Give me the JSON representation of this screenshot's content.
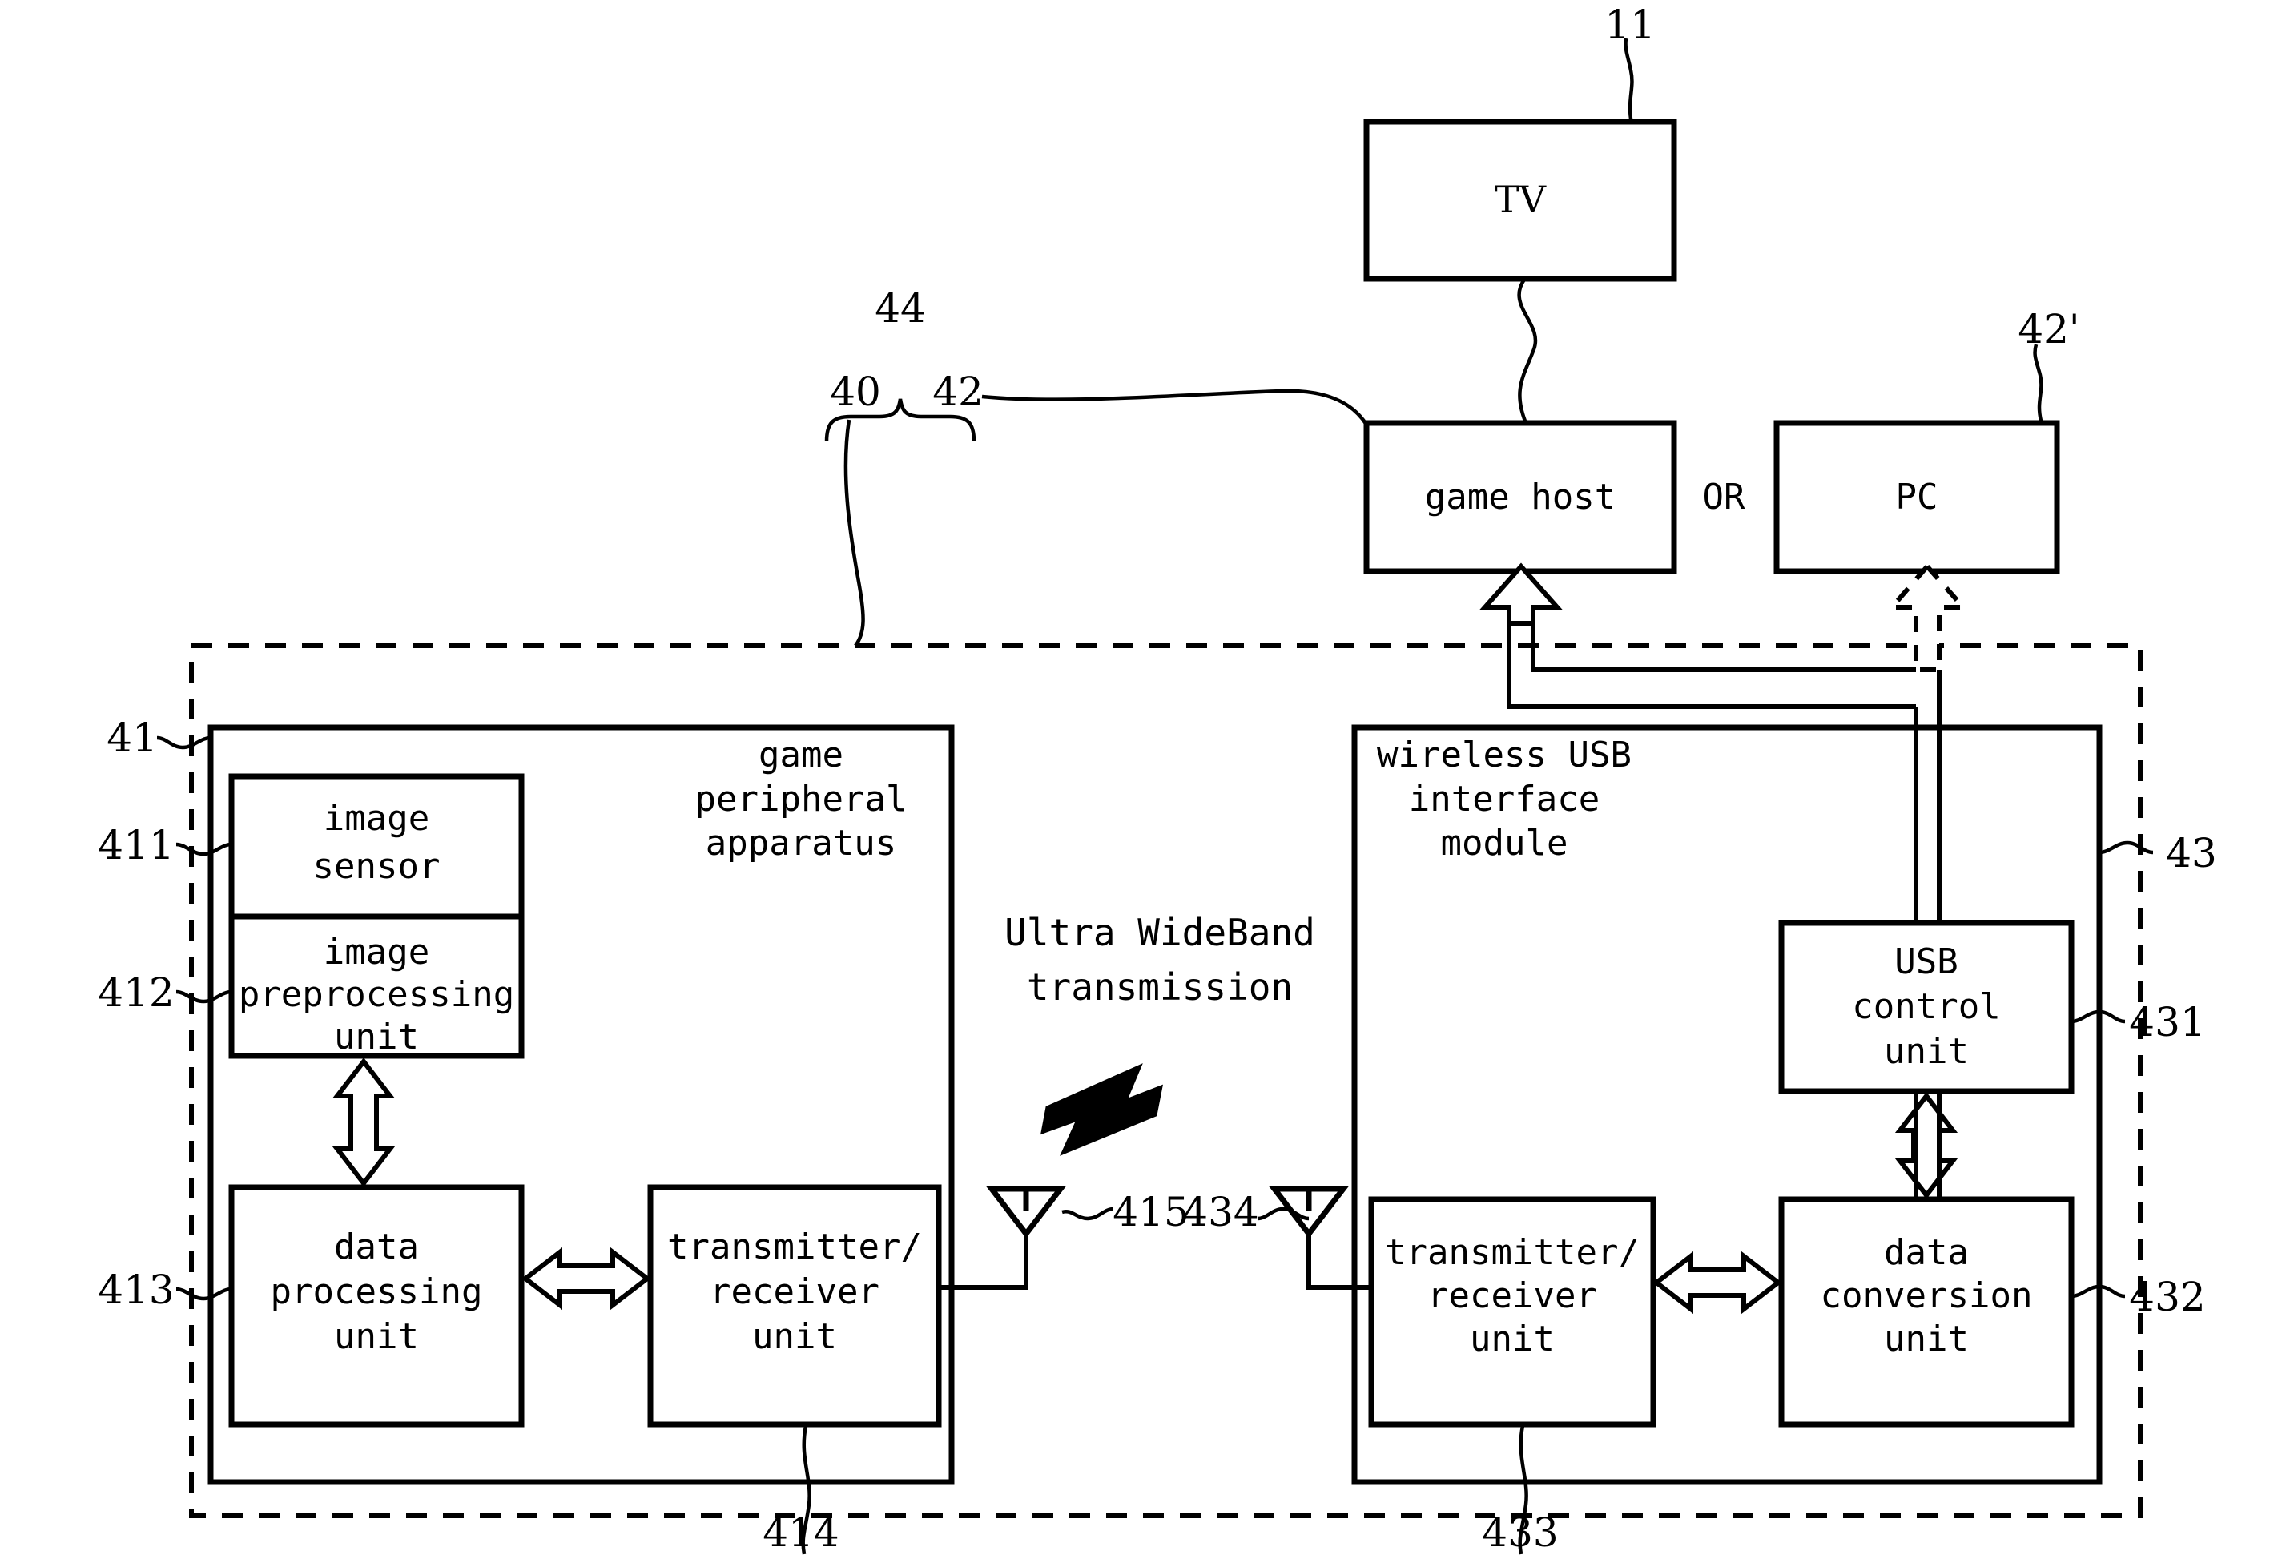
{
  "figure": {
    "type": "patent-block-diagram",
    "title": "Wireless USB game peripheral system block diagram",
    "background_color": "#ffffff",
    "line_color": "#000000"
  },
  "blocks": {
    "tv": {
      "label": "TV",
      "ref": "11"
    },
    "game_host": {
      "label": "game host",
      "ref": "42"
    },
    "or_separator": {
      "label": "OR"
    },
    "pc": {
      "label": "PC",
      "ref": "42'"
    },
    "system_dashed": {
      "ref": "40"
    },
    "brace_group": {
      "ref": "44"
    },
    "game_peripheral_apparatus": {
      "label_line1": "game",
      "label_line2": "peripheral",
      "label_line3": "apparatus",
      "ref": "41"
    },
    "image_sensor": {
      "label_line1": "image",
      "label_line2": "sensor",
      "ref": "411"
    },
    "image_preprocessing_unit": {
      "label_line1": "image",
      "label_line2": "preprocessing",
      "label_line3": "unit",
      "ref": "412"
    },
    "data_processing_unit": {
      "label_line1": "data",
      "label_line2": "processing",
      "label_line3": "unit",
      "ref": "413"
    },
    "peripheral_transceiver": {
      "label_line1": "transmitter/",
      "label_line2": "receiver",
      "label_line3": "unit",
      "ref": "414"
    },
    "peripheral_antenna": {
      "ref": "415"
    },
    "module_antenna": {
      "ref": "434"
    },
    "wireless_usb_interface_module": {
      "label_line1": "wireless USB",
      "label_line2": "interface",
      "label_line3": "module",
      "ref": "43"
    },
    "usb_control_unit": {
      "label_line1": "USB",
      "label_line2": "control",
      "label_line3": "unit",
      "ref": "431"
    },
    "data_conversion_unit": {
      "label_line1": "data",
      "label_line2": "conversion",
      "label_line3": "unit",
      "ref": "432"
    },
    "module_transceiver": {
      "label_line1": "transmitter/",
      "label_line2": "receiver",
      "label_line3": "unit",
      "ref": "433"
    }
  },
  "annotations": {
    "uwb_line1": "Ultra WideBand",
    "uwb_line2": "transmission"
  }
}
